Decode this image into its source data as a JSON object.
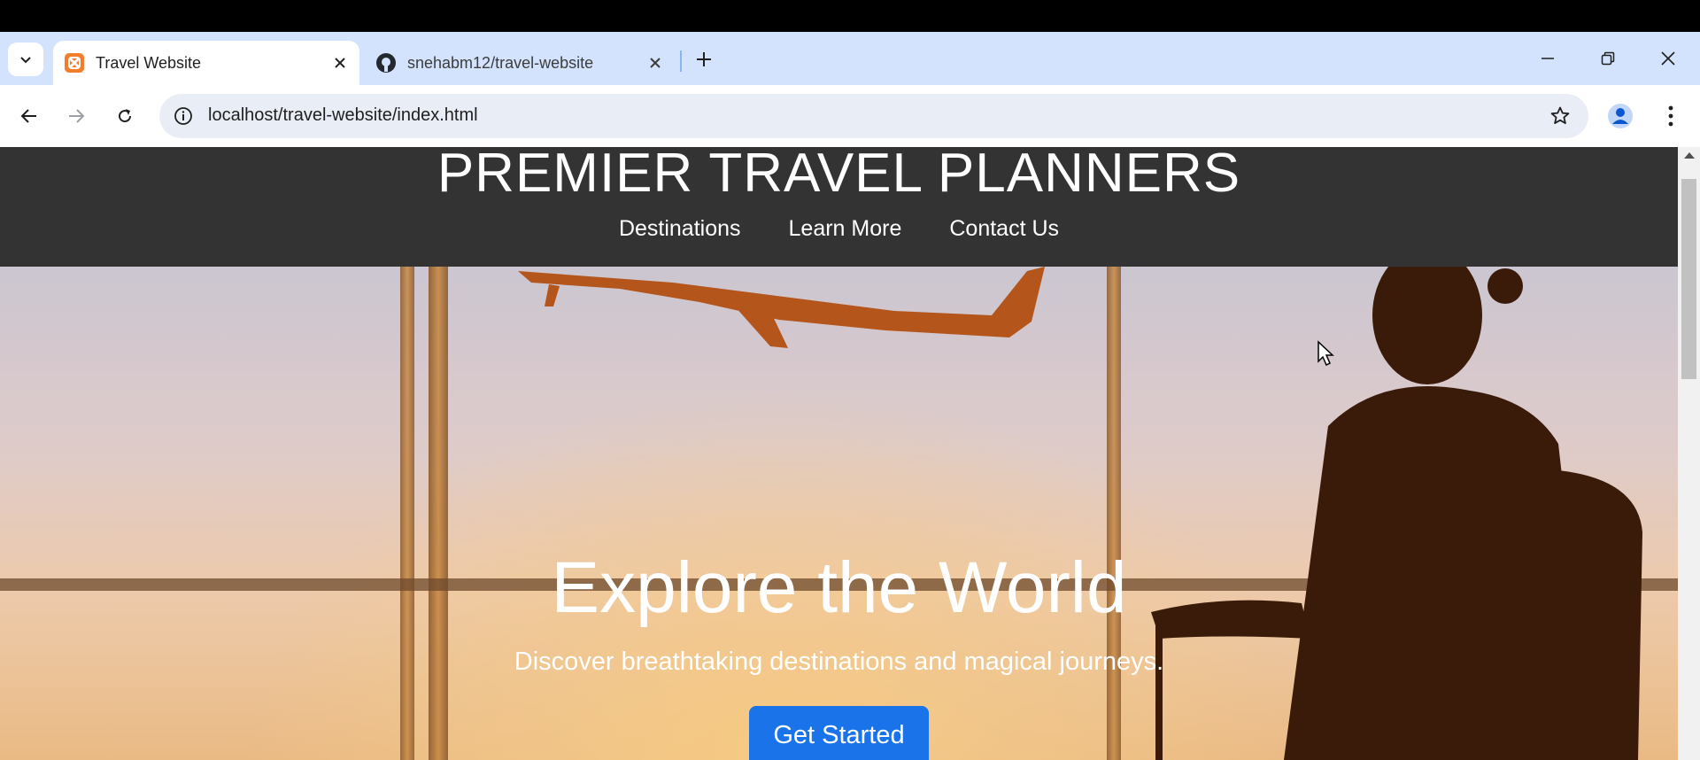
{
  "browser": {
    "tabs": [
      {
        "title": "Travel Website",
        "active": true,
        "favicon": "xampp-icon"
      },
      {
        "title": "snehabm12/travel-website",
        "active": false,
        "favicon": "github-icon"
      }
    ],
    "address": "localhost/travel-website/index.html"
  },
  "site": {
    "title": "PREMIER TRAVEL PLANNERS",
    "nav": [
      "Destinations",
      "Learn More",
      "Contact Us"
    ],
    "hero": {
      "title": "Explore the World",
      "subtitle": "Discover breathtaking destinations and magical journeys.",
      "cta": "Get Started"
    }
  },
  "colors": {
    "tabstrip": "#d3e3fd",
    "header": "#333333",
    "cta": "#1a73e8"
  }
}
